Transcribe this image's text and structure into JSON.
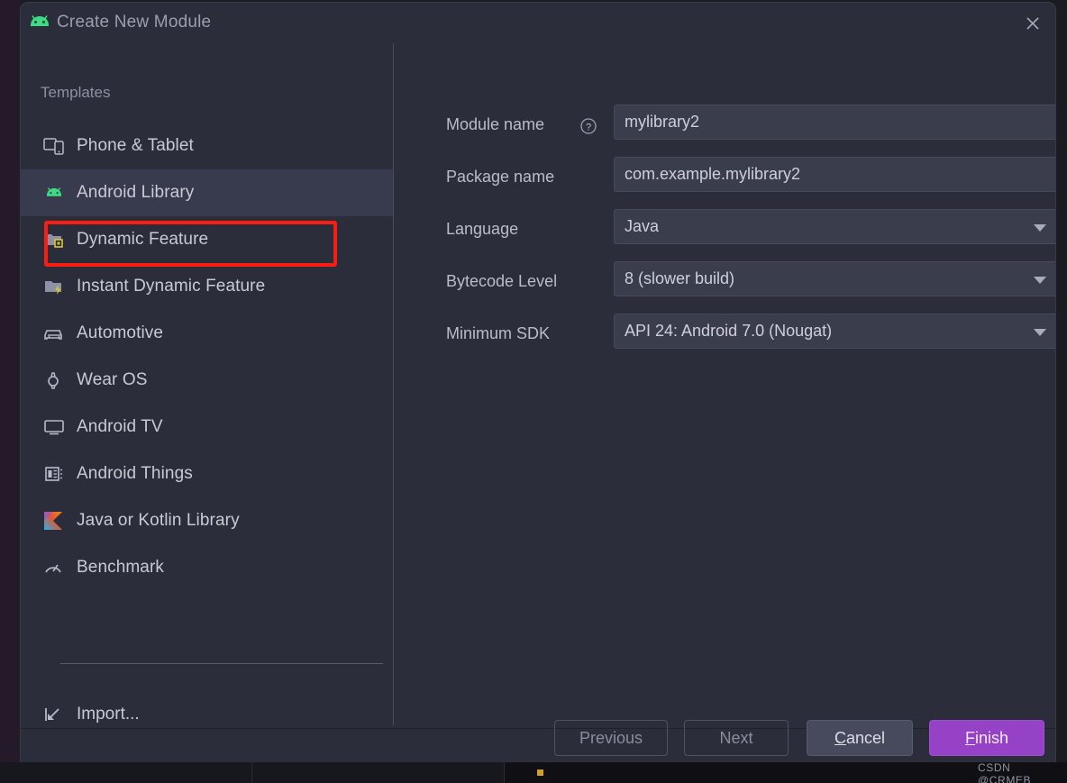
{
  "window": {
    "title": "Create New Module",
    "app_icon": "android-robot-icon",
    "close_icon": "close-icon"
  },
  "sidebar": {
    "section_label": "Templates",
    "items": [
      {
        "label": "Phone & Tablet",
        "icon": "phone-tablet-icon",
        "selected": false
      },
      {
        "label": "Android Library",
        "icon": "android-robot-icon",
        "selected": true
      },
      {
        "label": "Dynamic Feature",
        "icon": "dynamic-feature-icon",
        "selected": false
      },
      {
        "label": "Instant Dynamic Feature",
        "icon": "instant-feature-icon",
        "selected": false
      },
      {
        "label": "Automotive",
        "icon": "car-icon",
        "selected": false
      },
      {
        "label": "Wear OS",
        "icon": "watch-icon",
        "selected": false
      },
      {
        "label": "Android TV",
        "icon": "tv-icon",
        "selected": false
      },
      {
        "label": "Android Things",
        "icon": "things-board-icon",
        "selected": false
      },
      {
        "label": "Java or Kotlin Library",
        "icon": "kotlin-icon",
        "selected": false
      },
      {
        "label": "Benchmark",
        "icon": "speedometer-icon",
        "selected": false
      }
    ],
    "import": {
      "label": "Import...",
      "icon": "import-arrow-icon"
    }
  },
  "form": {
    "fields": [
      {
        "label": "Module name",
        "value": "mylibrary2",
        "type": "text",
        "help_icon": "question-mark-icon"
      },
      {
        "label": "Package name",
        "value": "com.example.mylibrary2",
        "type": "text",
        "help_icon": ""
      },
      {
        "label": "Language",
        "value": "Java",
        "type": "select",
        "help_icon": ""
      },
      {
        "label": "Bytecode Level",
        "value": "8 (slower build)",
        "type": "select",
        "help_icon": ""
      },
      {
        "label": "Minimum SDK",
        "value": "API 24: Android 7.0 (Nougat)",
        "type": "select",
        "help_icon": ""
      }
    ]
  },
  "footer": {
    "previous_label": "Previous",
    "next_label": "Next",
    "cancel_label": "Cancel",
    "cancel_mnemonic": "C",
    "cancel_rest": "ancel",
    "finish_label": "Finish",
    "finish_mnemonic": "F",
    "finish_rest": "inish"
  },
  "annotation": {
    "highlight_color": "#fb1d12",
    "highlight_target": "Android Library"
  },
  "watermark": {
    "text": "CSDN @CRMEB"
  },
  "colors": {
    "dialog_bg": "#2b2d3a",
    "field_bg": "#3a3d4b",
    "selection_bg": "#383b4d",
    "primary_button": "#9542c6",
    "android_green": "#3ddc84",
    "accent_red": "#fb1d12"
  }
}
